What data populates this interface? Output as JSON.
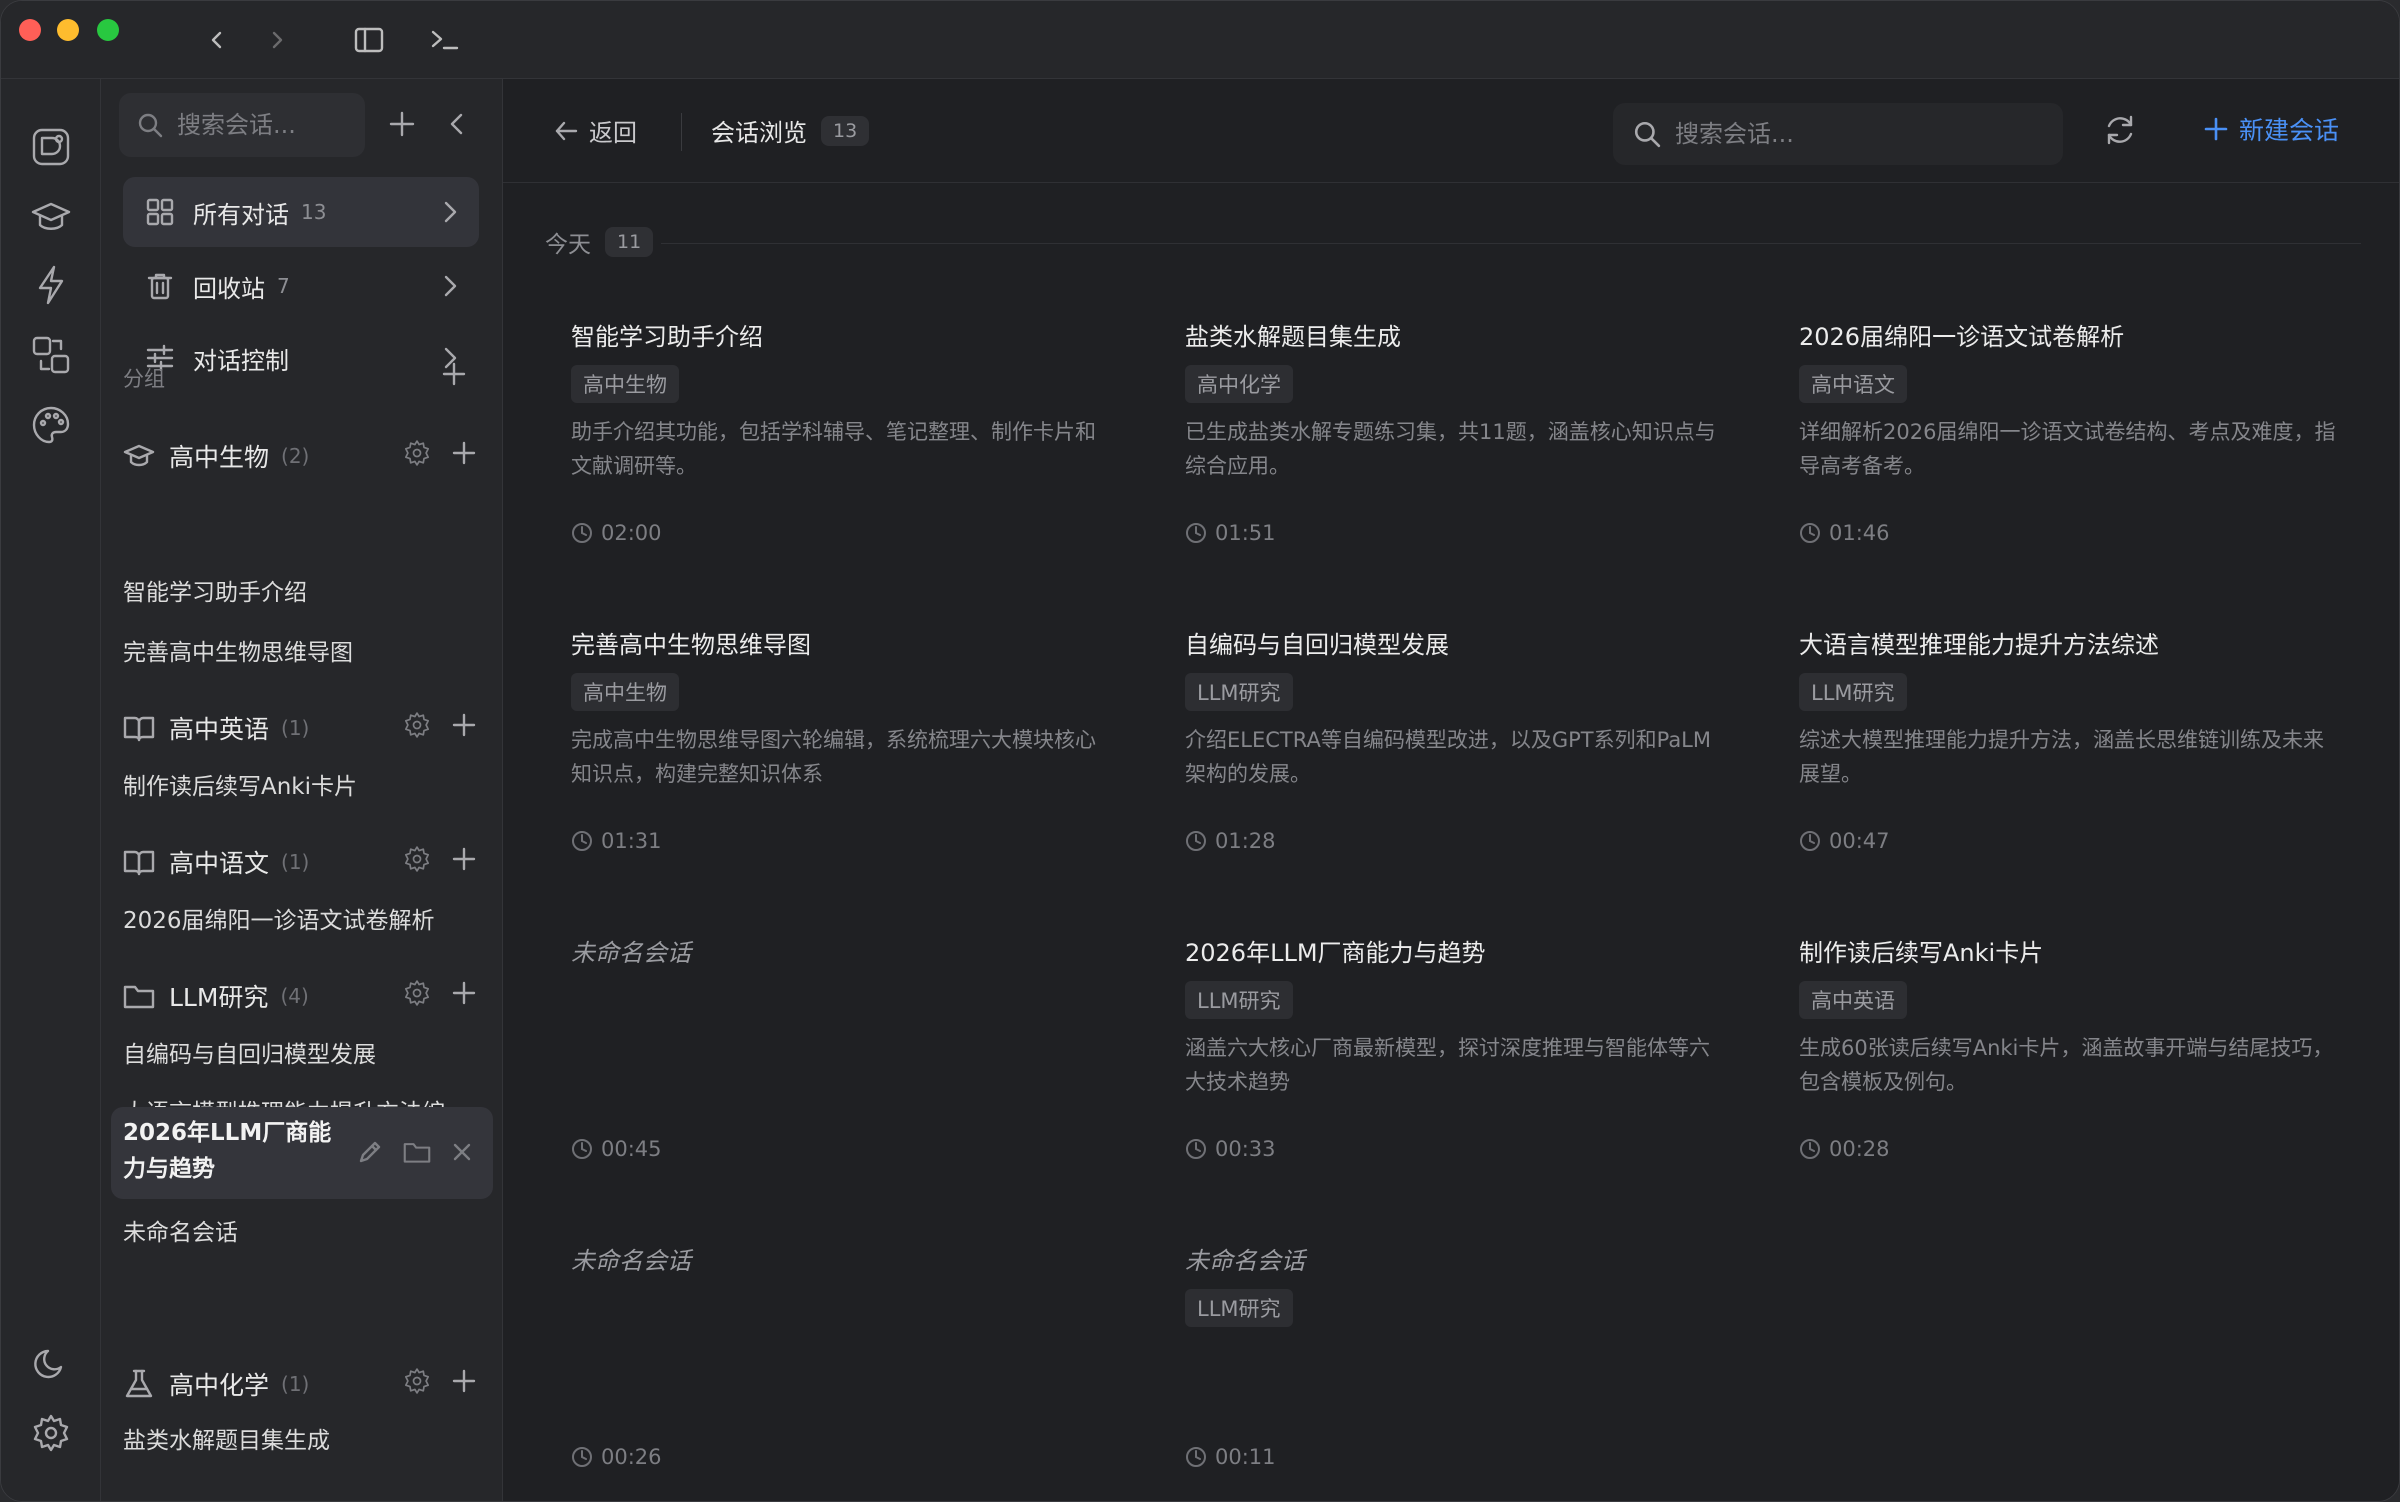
{
  "titlebar": {
    "back_glyph": "‹",
    "forward_glyph": "›",
    "terminal_glyph": ">_"
  },
  "rail": {
    "icons": [
      "notebook-logo-icon",
      "graduation-cap-icon",
      "bolt-icon",
      "translate-icon",
      "palette-icon"
    ],
    "bottom_icons": [
      "moon-icon",
      "gear-icon"
    ]
  },
  "sidebar": {
    "search_placeholder": "搜索会话...",
    "nav": [
      {
        "label": "所有对话",
        "count": "13"
      },
      {
        "label": "回收站",
        "count": "7"
      },
      {
        "label": "对话控制",
        "count": ""
      }
    ],
    "section_label": "分组",
    "groups": [
      {
        "name": "高中生物",
        "count": "(2)",
        "items": [
          "智能学习助手介绍",
          "完善高中生物思维导图"
        ]
      },
      {
        "name": "高中英语",
        "count": "(1)",
        "items": [
          "制作读后续写Anki卡片"
        ]
      },
      {
        "name": "高中语文",
        "count": "(1)",
        "items": [
          "2026届绵阳一诊语文试卷解析"
        ]
      },
      {
        "name": "LLM研究",
        "count": "(4)",
        "items": [
          "自编码与自回归模型发展",
          "大语言模型推理能力提升方法综述",
          "2026年LLM厂商能力与趋势",
          "未命名会话"
        ]
      },
      {
        "name": "高中化学",
        "count": "(1)",
        "items": [
          "盐类水解题目集生成"
        ]
      }
    ],
    "item_multiline": {
      "llm_1_line1": "大语言模型推理能力提升方法综",
      "llm_1_line2": "述",
      "llm_2_line1": "2026年LLM厂商能",
      "llm_2_line2": "力与趋势"
    }
  },
  "main": {
    "back_label": "返回",
    "title": "会话浏览",
    "title_count": "13",
    "search_placeholder": "搜索会话...",
    "new_label": "新建会话",
    "day_label": "今天",
    "day_count": "11",
    "cards": [
      {
        "title": "智能学习助手介绍",
        "tag": "高中生物",
        "desc": "助手介绍其功能，包括学科辅导、笔记整理、制作卡片和文献调研等。",
        "time": "02:00",
        "untitled": false
      },
      {
        "title": "盐类水解题目集生成",
        "tag": "高中化学",
        "desc": "已生成盐类水解专题练习集，共11题，涵盖核心知识点与综合应用。",
        "time": "01:51",
        "untitled": false
      },
      {
        "title": "2026届绵阳一诊语文试卷解析",
        "tag": "高中语文",
        "desc": "详细解析2026届绵阳一诊语文试卷结构、考点及难度，指导高考备考。",
        "time": "01:46",
        "untitled": false
      },
      {
        "title": "完善高中生物思维导图",
        "tag": "高中生物",
        "desc": "完成高中生物思维导图六轮编辑，系统梳理六大模块核心知识点，构建完整知识体系",
        "time": "01:31",
        "untitled": false
      },
      {
        "title": "自编码与自回归模型发展",
        "tag": "LLM研究",
        "desc": "介绍ELECTRA等自编码模型改进，以及GPT系列和PaLM架构的发展。",
        "time": "01:28",
        "untitled": false
      },
      {
        "title": "大语言模型推理能力提升方法综述",
        "tag": "LLM研究",
        "desc": "综述大模型推理能力提升方法，涵盖长思维链训练及未来展望。",
        "time": "00:47",
        "untitled": false
      },
      {
        "title": "未命名会话",
        "tag": "",
        "desc": "",
        "time": "00:45",
        "untitled": true
      },
      {
        "title": "2026年LLM厂商能力与趋势",
        "tag": "LLM研究",
        "desc": "涵盖六大核心厂商最新模型，探讨深度推理与智能体等六大技术趋势",
        "time": "00:33",
        "untitled": false
      },
      {
        "title": "制作读后续写Anki卡片",
        "tag": "高中英语",
        "desc": "生成60张读后续写Anki卡片，涵盖故事开端与结尾技巧，包含模板及例句。",
        "time": "00:28",
        "untitled": false
      },
      {
        "title": "未命名会话",
        "tag": "",
        "desc": "",
        "time": "00:26",
        "untitled": true
      },
      {
        "title": "未命名会话",
        "tag": "LLM研究",
        "desc": "",
        "time": "00:11",
        "untitled": true
      }
    ]
  },
  "colors": {
    "accent": "#4a90f5",
    "bg": "#1f2023",
    "panel": "#26272a"
  }
}
